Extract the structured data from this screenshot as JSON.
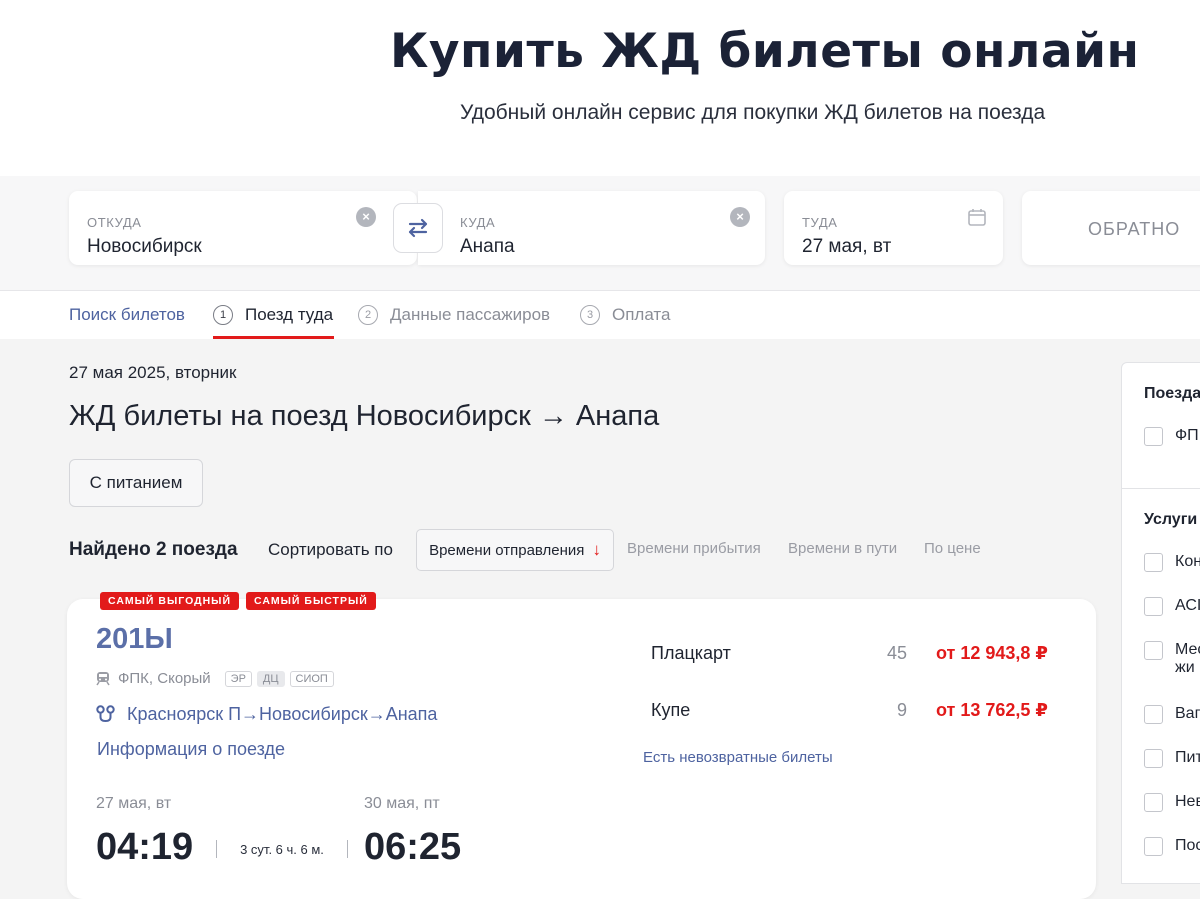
{
  "hero": {
    "title": "Купить ЖД билеты онлайн",
    "subtitle": "Удобный онлайн сервис для покупки ЖД билетов на поезда"
  },
  "search": {
    "from_label": "ОТКУДА",
    "from_value": "Новосибирск",
    "to_label": "КУДА",
    "to_value": "Анапа",
    "date_label": "ТУДА",
    "date_value": "27 мая, вт",
    "return_label": "ОБРАТНО"
  },
  "steps": [
    {
      "label": "Поиск билетов"
    },
    {
      "num": "1",
      "label": "Поезд туда"
    },
    {
      "num": "2",
      "label": "Данные пассажиров"
    },
    {
      "num": "3",
      "label": "Оплата"
    }
  ],
  "main": {
    "date_line": "27 мая 2025, вторник",
    "title": "ЖД билеты на поезд Новосибирск → Анапа",
    "filter_chip": "С питанием",
    "found": "Найдено 2 поезда",
    "sort_label": "Сортировать по",
    "sort_options": [
      "Времени отправления",
      "Времени прибытия",
      "Времени в пути",
      "По цене"
    ],
    "sort_arrow": "↓"
  },
  "train": {
    "badges": [
      "САМЫЙ ВЫГОДНЫЙ",
      "САМЫЙ БЫСТРЫЙ"
    ],
    "number": "201Ы",
    "carrier": "ФПК, Скорый",
    "tags": [
      "ЭР",
      "ДЦ",
      "СИОП"
    ],
    "route": "Красноярск П→Новосибирск→Анапа",
    "info_link": "Информация о поезде",
    "departure_date": "27 мая, вт",
    "departure_time": "04:19",
    "duration": "3 сут. 6 ч. 6 м.",
    "arrival_date": "30 мая, пт",
    "arrival_time": "06:25",
    "classes": [
      {
        "name": "Плацкарт",
        "seats": "45",
        "price": "от 12 943,8 ₽"
      },
      {
        "name": "Купе",
        "seats": "9",
        "price": "от 13 762,5 ₽"
      }
    ],
    "nonrefundable": "Есть невозвратные билеты"
  },
  "sidebar": {
    "section1_title": "Поезда",
    "section1_items": [
      "ФП"
    ],
    "section2_title": "Услуги",
    "section2_items": [
      "Кон",
      "АСІ",
      "Мес\nжи",
      "Ваг",
      "Пит",
      "Нев",
      "Пос"
    ]
  },
  "colors": {
    "accent_red": "#e21a1a",
    "link_blue": "#4e63a0",
    "train_number": "#5b6fa8"
  }
}
